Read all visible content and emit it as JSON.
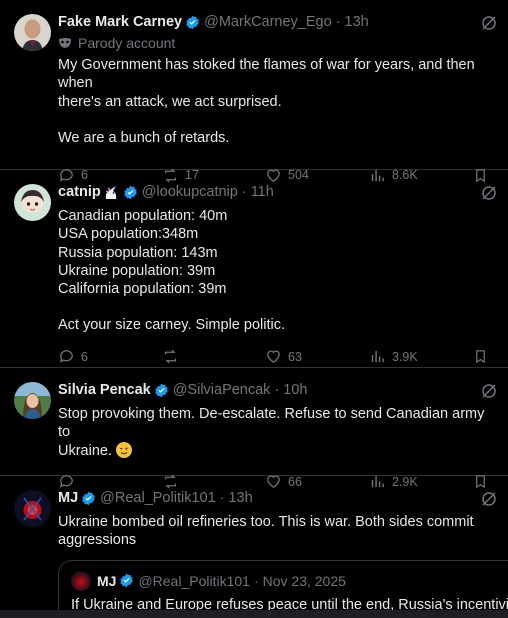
{
  "colors": {
    "background": "#000000",
    "text": "#e7e9ea",
    "muted": "#71767b",
    "verified": "#1d9bf0",
    "divider": "#2f3336"
  },
  "tweets": [
    {
      "name": "Fake Mark Carney",
      "handle": "@MarkCarney_Ego",
      "time": "13h",
      "label": "Parody account",
      "lines": [
        "My Government has stoked the flames of war for years, and then when",
        "there's an attack, we act surprised.",
        "",
        "We are a bunch of retards."
      ],
      "replies": "6",
      "reposts": "17",
      "likes": "504",
      "views": "8.6K"
    },
    {
      "name": "catnip",
      "handle": "@lookupcatnip",
      "time": "11h",
      "lines": [
        "Canadian population: 40m",
        "USA population:348m",
        "Russia population: 143m",
        "Ukraine population: 39m",
        "California population: 39m",
        "",
        "Act your size carney. Simple politic."
      ],
      "replies": "6",
      "reposts": "",
      "likes": "63",
      "views": "3.9K"
    },
    {
      "name": "Silvia Pencak",
      "handle": "@SilviaPencak",
      "time": "10h",
      "lines": [
        "Stop provoking them. De-escalate. Refuse to send Canadian army to",
        "Ukraine."
      ],
      "replies": "",
      "reposts": "",
      "likes": "66",
      "views": "2.9K"
    },
    {
      "name": "MJ",
      "handle": "@Real_Politik101",
      "time": "13h",
      "lines": [
        "Ukraine bombed oil refineries too. This is war. Both sides commit",
        "aggressions"
      ],
      "quote": {
        "name": "MJ",
        "handle": "@Real_Politik101",
        "time": "Nov 23, 2025",
        "text": "If Ukraine and Europe refuses peace until the end, Russia's incentivized"
      }
    }
  ]
}
